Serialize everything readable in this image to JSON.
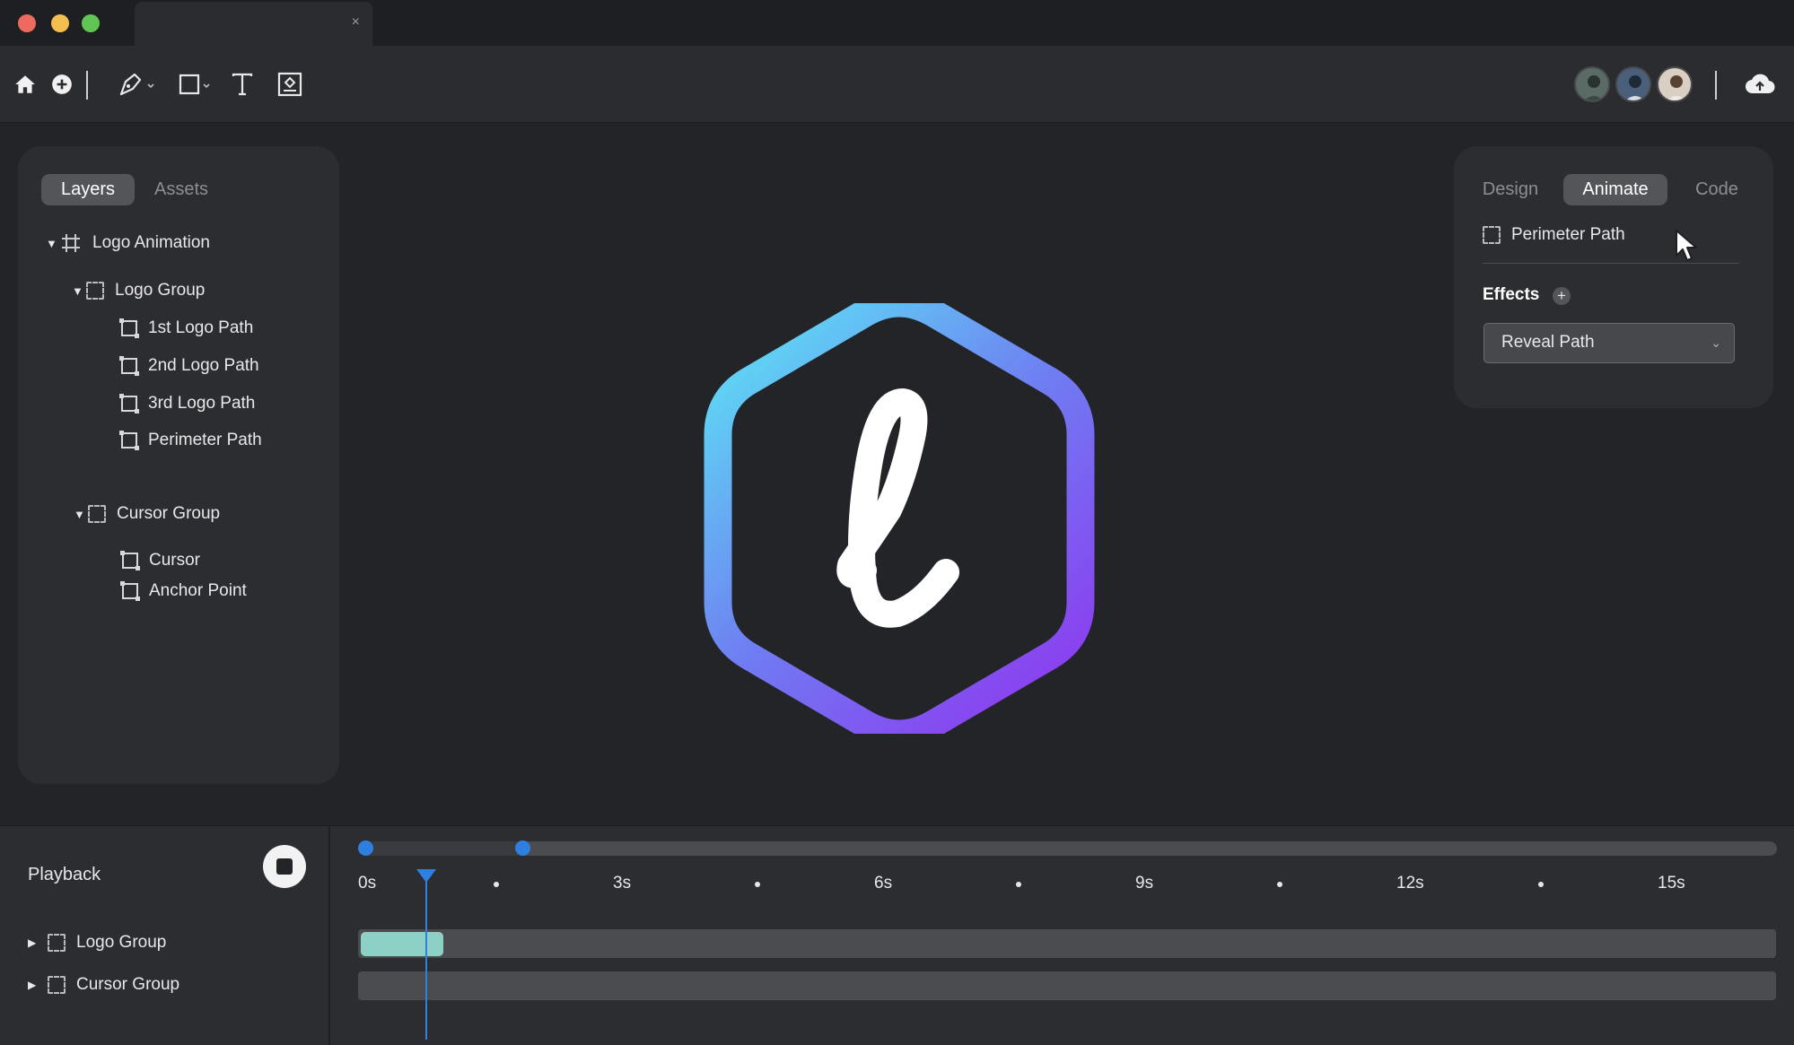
{
  "window": {
    "tab_close_glyph": "×"
  },
  "toolbar": {
    "tools": [
      "home-icon",
      "add-circle-icon",
      "pen-tool-icon",
      "rectangle-tool-icon",
      "text-tool-icon",
      "component-tool-icon"
    ],
    "actions": [
      "cloud-upload-icon"
    ]
  },
  "layers_panel": {
    "tabs": [
      {
        "label": "Layers",
        "active": true
      },
      {
        "label": "Assets",
        "active": false
      }
    ],
    "tree": {
      "root": "Logo Animation",
      "logo_group": {
        "label": "Logo Group",
        "children": [
          "1st Logo Path",
          "2nd Logo Path",
          "3rd Logo Path",
          "Perimeter Path"
        ]
      },
      "cursor_group": {
        "label": "Cursor Group",
        "children": [
          "Cursor",
          "Anchor Point"
        ]
      }
    }
  },
  "props_panel": {
    "tabs": [
      {
        "label": "Design",
        "active": false
      },
      {
        "label": "Animate",
        "active": true
      },
      {
        "label": "Code",
        "active": false
      }
    ],
    "selection": "Perimeter Path",
    "effects_title": "Effects",
    "effects_add": "+",
    "effect_select_value": "Reveal Path"
  },
  "timeline": {
    "playback_label": "Playback",
    "ruler": [
      "0s",
      "3s",
      "6s",
      "9s",
      "12s",
      "15s"
    ],
    "tracks": [
      "Logo Group",
      "Cursor Group"
    ],
    "duration_s": 16.5,
    "playhead_s": 0.7,
    "range_start_s": 0,
    "range_end_s": 1.8,
    "clip_start_s": 0,
    "clip_end_s": 0.95
  },
  "colors": {
    "gradient_start": "#5fd6f4",
    "gradient_mid": "#6f7cf2",
    "gradient_end": "#8b3ff0",
    "accent_blue": "#2f7fe0",
    "clip_teal": "#8dd1c6"
  }
}
